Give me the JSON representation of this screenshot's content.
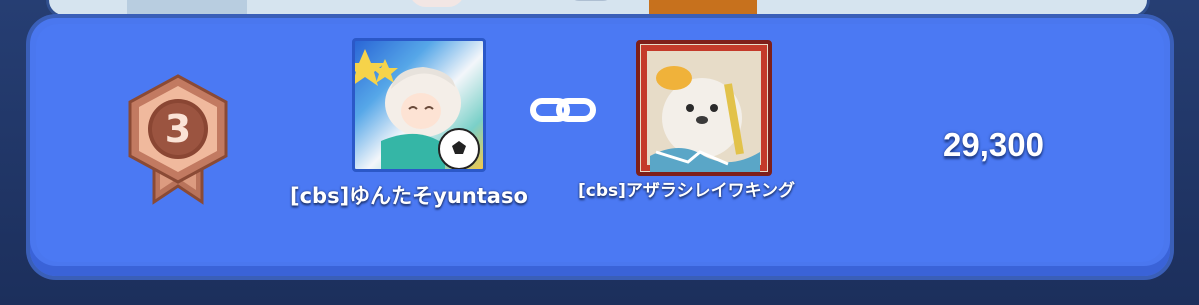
{
  "entry": {
    "rank": "3",
    "player_1": {
      "name": "[cbs]ゆんたそyuntaso",
      "avatar": "anime-girl-soccer-avatar"
    },
    "player_2": {
      "name": "[cbs]アザラシレイワキング",
      "avatar": "seal-king-avatar"
    },
    "link_icon": "link-chain-icon",
    "score": "29,300"
  },
  "colors": {
    "card": "#4a77ef",
    "background": "#1f3466",
    "medal_bronze": "#d79a80"
  }
}
